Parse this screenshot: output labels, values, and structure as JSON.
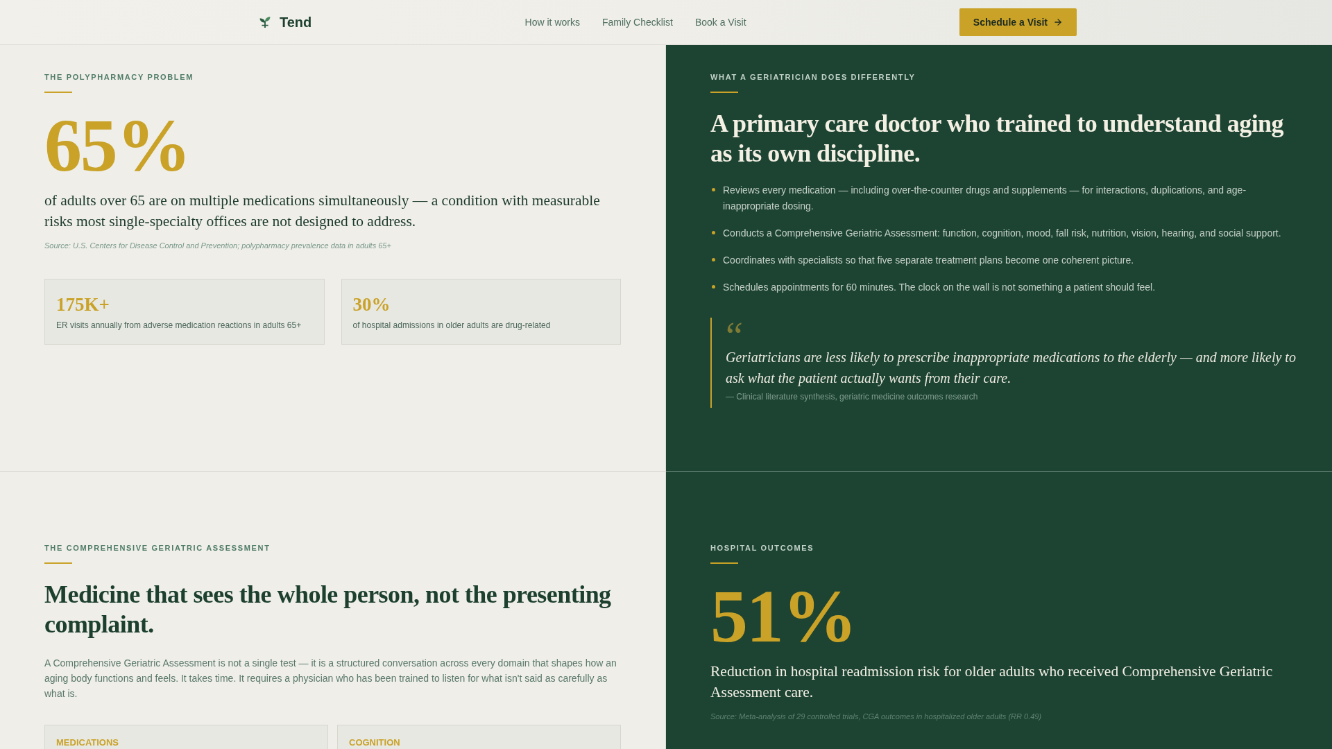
{
  "header": {
    "brand": "Tend",
    "nav": [
      {
        "label": "How it works"
      },
      {
        "label": "Family Checklist"
      },
      {
        "label": "Book a Visit"
      }
    ],
    "cta": "Schedule a Visit"
  },
  "sections": [
    {
      "kind": "stat",
      "dark": false,
      "eyebrow": "THE POLYPHARMACY PROBLEM",
      "figure": "65%",
      "description": "of adults over 65 are on multiple medications simultaneously — a condition with measurable risks most single-specialty offices are not designed to address.",
      "source": "Source: U.S. Centers for Disease Control and Prevention; polypharmacy prevalence data in adults 65+",
      "stats": [
        {
          "value": "175K+",
          "caption": "ER visits annually from adverse medication reactions in adults 65+"
        },
        {
          "value": "30%",
          "caption": "of hospital admissions in older adults are drug-related"
        }
      ]
    },
    {
      "kind": "list",
      "dark": true,
      "eyebrow": "WHAT A GERIATRICIAN DOES DIFFERENTLY",
      "heading": "A primary care doctor who trained to understand aging as its own discipline.",
      "bullets": [
        "Reviews every medication — including over-the-counter drugs and supplements — for interactions, duplications, and age-inappropriate dosing.",
        "Conducts a Comprehensive Geriatric Assessment: function, cognition, mood, fall risk, nutrition, vision, hearing, and social support.",
        "Coordinates with specialists so that five separate treatment plans become one coherent picture.",
        "Schedules appointments for 60 minutes. The clock on the wall is not something a patient should feel."
      ],
      "quote": {
        "mark": "“",
        "text": "Geriatricians are less likely to prescribe inappropriate medications to the elderly — and more likely to ask what the patient actually wants from their care.",
        "attribution": "— Clinical literature synthesis, geriatric medicine outcomes research"
      }
    },
    {
      "kind": "text",
      "dark": false,
      "eyebrow": "THE COMPREHENSIVE GERIATRIC ASSESSMENT",
      "heading": "Medicine that sees the whole person, not the presenting complaint.",
      "body": "A Comprehensive Geriatric Assessment is not a single test — it is a structured conversation across every domain that shapes how an aging body functions and feels. It takes time. It requires a physician who has been trained to listen for what isn't said as carefully as what is.",
      "domains": [
        {
          "label": "MEDICATIONS"
        },
        {
          "label": "COGNITION"
        }
      ]
    },
    {
      "kind": "stat",
      "dark": true,
      "eyebrow": "HOSPITAL OUTCOMES",
      "figure": "51%",
      "description": "Reduction in hospital readmission risk for older adults who received Comprehensive Geriatric Assessment care.",
      "source": "Source: Meta-analysis of 29 controlled trials, CGA outcomes in hospitalized older adults (RR 0.49)"
    }
  ]
}
